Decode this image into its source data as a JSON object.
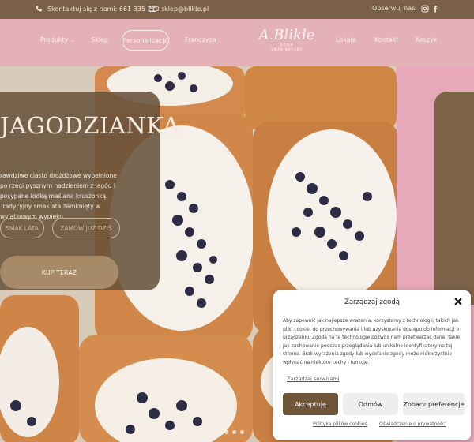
{
  "colors": {
    "topbar_bg": "#7a6048",
    "nav_bg": "#e4b1b7",
    "hero_side_bg": "#e7a9b9",
    "card_bg": "#68523a",
    "accent_brown": "#6f5539"
  },
  "topbar": {
    "phone_icon": "phone-icon",
    "phone_text": "Skontaktuj się z nami: 661 335 210",
    "mail_icon": "mail-icon",
    "email": "sklep@blikle.pl",
    "follow_label": "Obserwuj nas:",
    "social": [
      "instagram-icon",
      "facebook-icon"
    ]
  },
  "nav": {
    "items": [
      {
        "label": "Produkty"
      },
      {
        "label": "Sklep"
      },
      {
        "label": "Personalizacja"
      },
      {
        "label": "Franczyza"
      },
      {
        "label": "Lokale"
      },
      {
        "label": "Kontakt"
      },
      {
        "label": "Koszyk"
      }
    ],
    "logo": {
      "brand": "A.Blikle",
      "year": "1869",
      "tagline": "SMAK NATURY"
    }
  },
  "hero": {
    "title": "JAGODZIANKA",
    "description": "rawdziwe ciasto drożdżowe wypełnione po rzegi pysznym nadzieniem z jagód i posypane łodką maślaną kruszonką. Tradycyjny smak ata zamknięty w wyjątkowym wypieku.",
    "btn_smak": "SMAK LATA",
    "btn_zamow": "ZAMÓW JUŻ DZIŚ",
    "btn_kup": "KUP TERAZ"
  },
  "cookie": {
    "title": "Zarządzaj zgodą",
    "text": "Aby zapewnić jak najlepsze wrażenia, korzystamy z technologii, takich jak pliki cookie, do przechowywania i/lub uzyskiwania dostępu do informacji o urządzeniu. Zgoda na te technologie pozwoli nam przetwarzać dane, takie jak zachowanie podczas przeglądania lub unikalne identyfikatory na tej stronie. Brak wyrażenia zgody lub wycofanie zgody może niekorzystnie wpłynąć na niektóre cechy i funkcje.",
    "manage_link": "Zarządzaj serwisami",
    "accept": "Akceptuję",
    "deny": "Odmów",
    "prefs": "Zobacz preferencje",
    "privacy": "Polityka plików cookies",
    "declaration": "Oświadczenie o prywatności"
  }
}
